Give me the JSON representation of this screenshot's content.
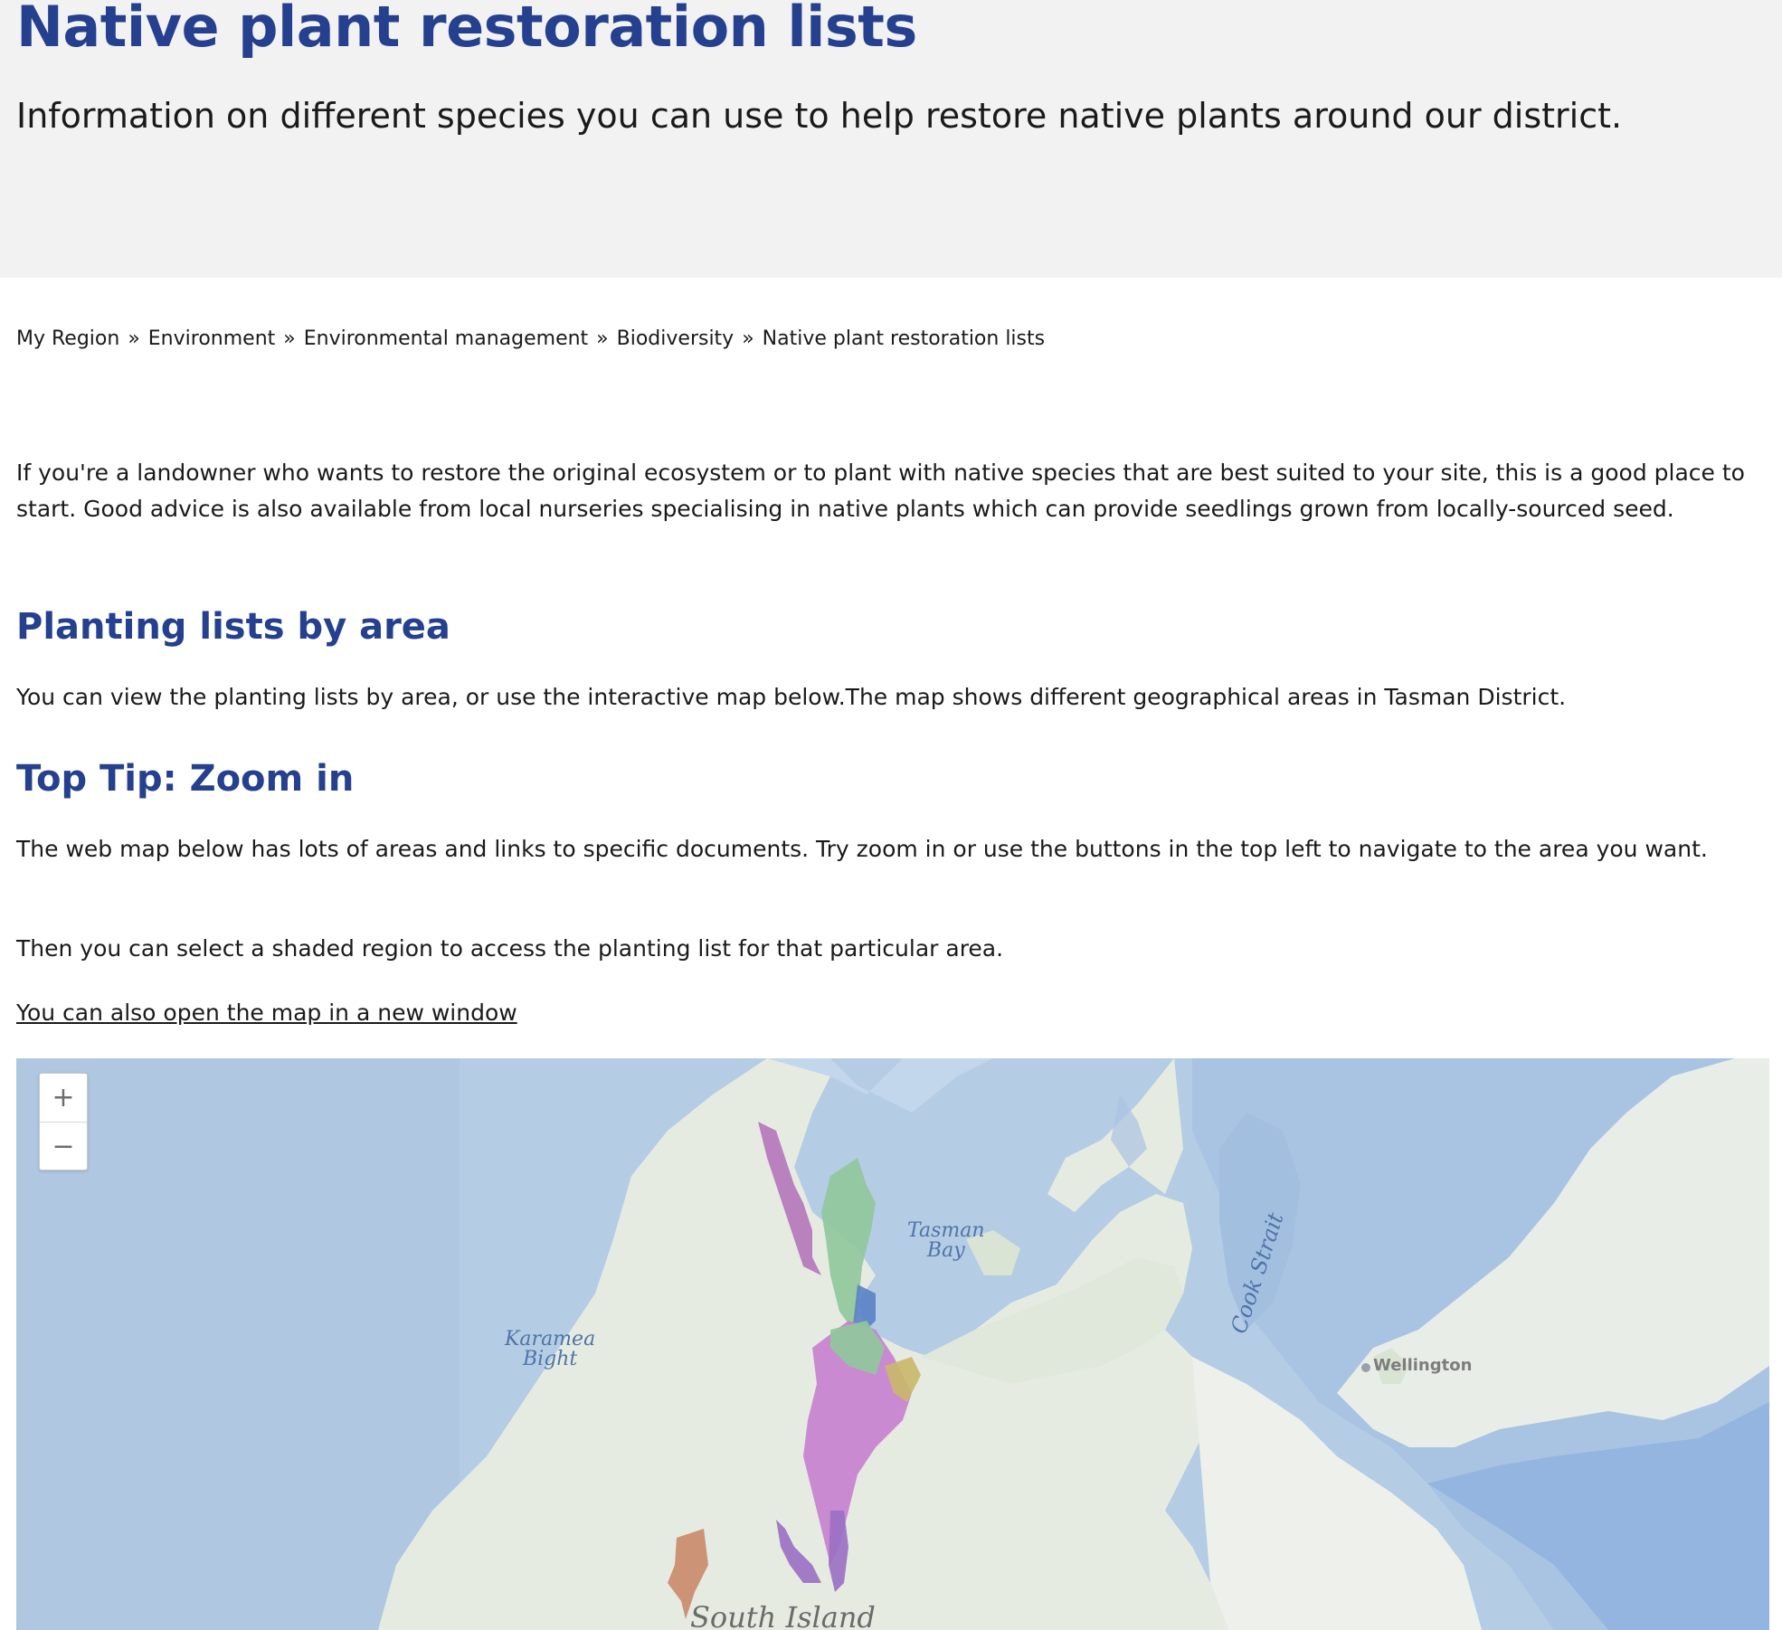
{
  "hero": {
    "title": "Native plant restoration lists",
    "subtitle": "Information on different species you can use to help restore native plants around our district."
  },
  "breadcrumb": {
    "items": [
      "My Region",
      "Environment",
      "Environmental management",
      "Biodiversity",
      "Native plant restoration lists"
    ],
    "separator": "»"
  },
  "intro": {
    "paragraph": "If you're a landowner who wants to restore the original ecosystem or to plant with native species that are best suited to your site, this is a good place to start. Good advice is also available from local nurseries specialising in native plants which can provide seedlings grown from locally-sourced seed."
  },
  "section_area": {
    "heading": "Planting lists by area",
    "paragraph": "You can view the planting lists by area, or use the interactive map below.The map shows different geographical areas in Tasman District."
  },
  "section_tip": {
    "heading": "Top Tip: Zoom in",
    "paragraph1": "The web map below has lots of areas and links to specific documents. Try zoom in or use the buttons in the top left to navigate to the area you want.",
    "paragraph2": "Then you can select a shaded region to access the planting list for that particular area.",
    "link": "You can also open the map in a new window"
  },
  "map": {
    "zoom_in": "+",
    "zoom_out": "−",
    "labels": {
      "tasman_bay_1": "Tasman",
      "tasman_bay_2": "Bay",
      "karamea_1": "Karamea",
      "karamea_2": "Bight",
      "cook_strait": "Cook Strait",
      "wellington": "Wellington",
      "south_island": "South Island"
    },
    "colors": {
      "sea": "#b4cde4",
      "land": "#e6ebe2",
      "region_pink": "#c77fcf",
      "region_green": "#8fc89a",
      "region_purple": "#9a6fc4",
      "region_orange": "#c98a6a"
    }
  }
}
